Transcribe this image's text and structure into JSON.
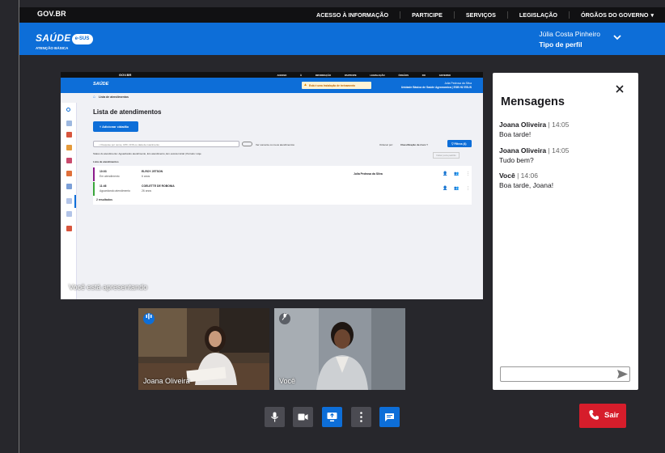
{
  "gov_bar": {
    "logo": "GOV.BR",
    "links": [
      "ACESSO À INFORMAÇÃO",
      "PARTICIPE",
      "SERVIÇOS",
      "LEGISLAÇÃO",
      "ÓRGÃOS DO GOVERNO"
    ]
  },
  "app_bar": {
    "logo_word": "SAÚDE",
    "logo_badge": "e-SUS",
    "logo_sub": "ATENÇÃO BÁSICA",
    "user_name": "Júlia Costa Pinheiro",
    "user_role": "Tipo de perfil"
  },
  "shared_screen": {
    "banner": "Está é uma  Instalação de treinamento",
    "user_line1": "Julia Pedrosa da Silva",
    "user_line2": "Unidade Básica de Saúde Agronomica | ESB H2 ESUS",
    "breadcrumb": "Lista de atendimentos",
    "title": "Lista de atendimentos",
    "add_button": "Adicionar cidadão",
    "search_placeholder": "Pesquise por nome, CPF, CNS ou data de nascimento",
    "toggle_label": "Ver somente os meus atendimentos",
    "order_label": "Ordenar por:",
    "order_value": "Classificação de risco",
    "filter_button": "Filtros (4)",
    "reset_link": "Voltar para padrão",
    "status_line": "Status do atendimento: Aguardando atendimento, Em atendimento, Em escuta inicial | Período: Hoje",
    "list_label": "Lista de atendimentos",
    "rows": [
      {
        "time": "10:03",
        "status": "Em atendimento",
        "name": "ELROY JETSON",
        "age": "6 anos",
        "professional": "Julia Pedrosa da Silva",
        "color": "#8b1a8b"
      },
      {
        "time": "11:46",
        "status": "Aguardando atendimento",
        "name": "COELETTE DE ROBONIA",
        "age": "26 anos",
        "professional": "",
        "color": "#3aa53a"
      }
    ],
    "results": "2 resultados",
    "presenting_label": "Você está apresentando"
  },
  "chat": {
    "title": "Mensagens",
    "messages": [
      {
        "name": "Joana Oliveira",
        "time": "14:05",
        "text": "Boa tarde!"
      },
      {
        "name": "Joana Oliveira",
        "time": "14:05",
        "text": "Tudo bem?"
      },
      {
        "name": "Você",
        "time": "14:06",
        "text": "Boa tarde, Joana!"
      }
    ]
  },
  "participants": [
    {
      "name": "Joana Oliveira",
      "state": "speaking"
    },
    {
      "name": "Você",
      "state": "muted"
    }
  ],
  "controls": {
    "leave_label": "Sair"
  },
  "colors": {
    "brand_blue": "#0d6ed8",
    "leave_red": "#d61d2b",
    "background": "#27272c"
  }
}
